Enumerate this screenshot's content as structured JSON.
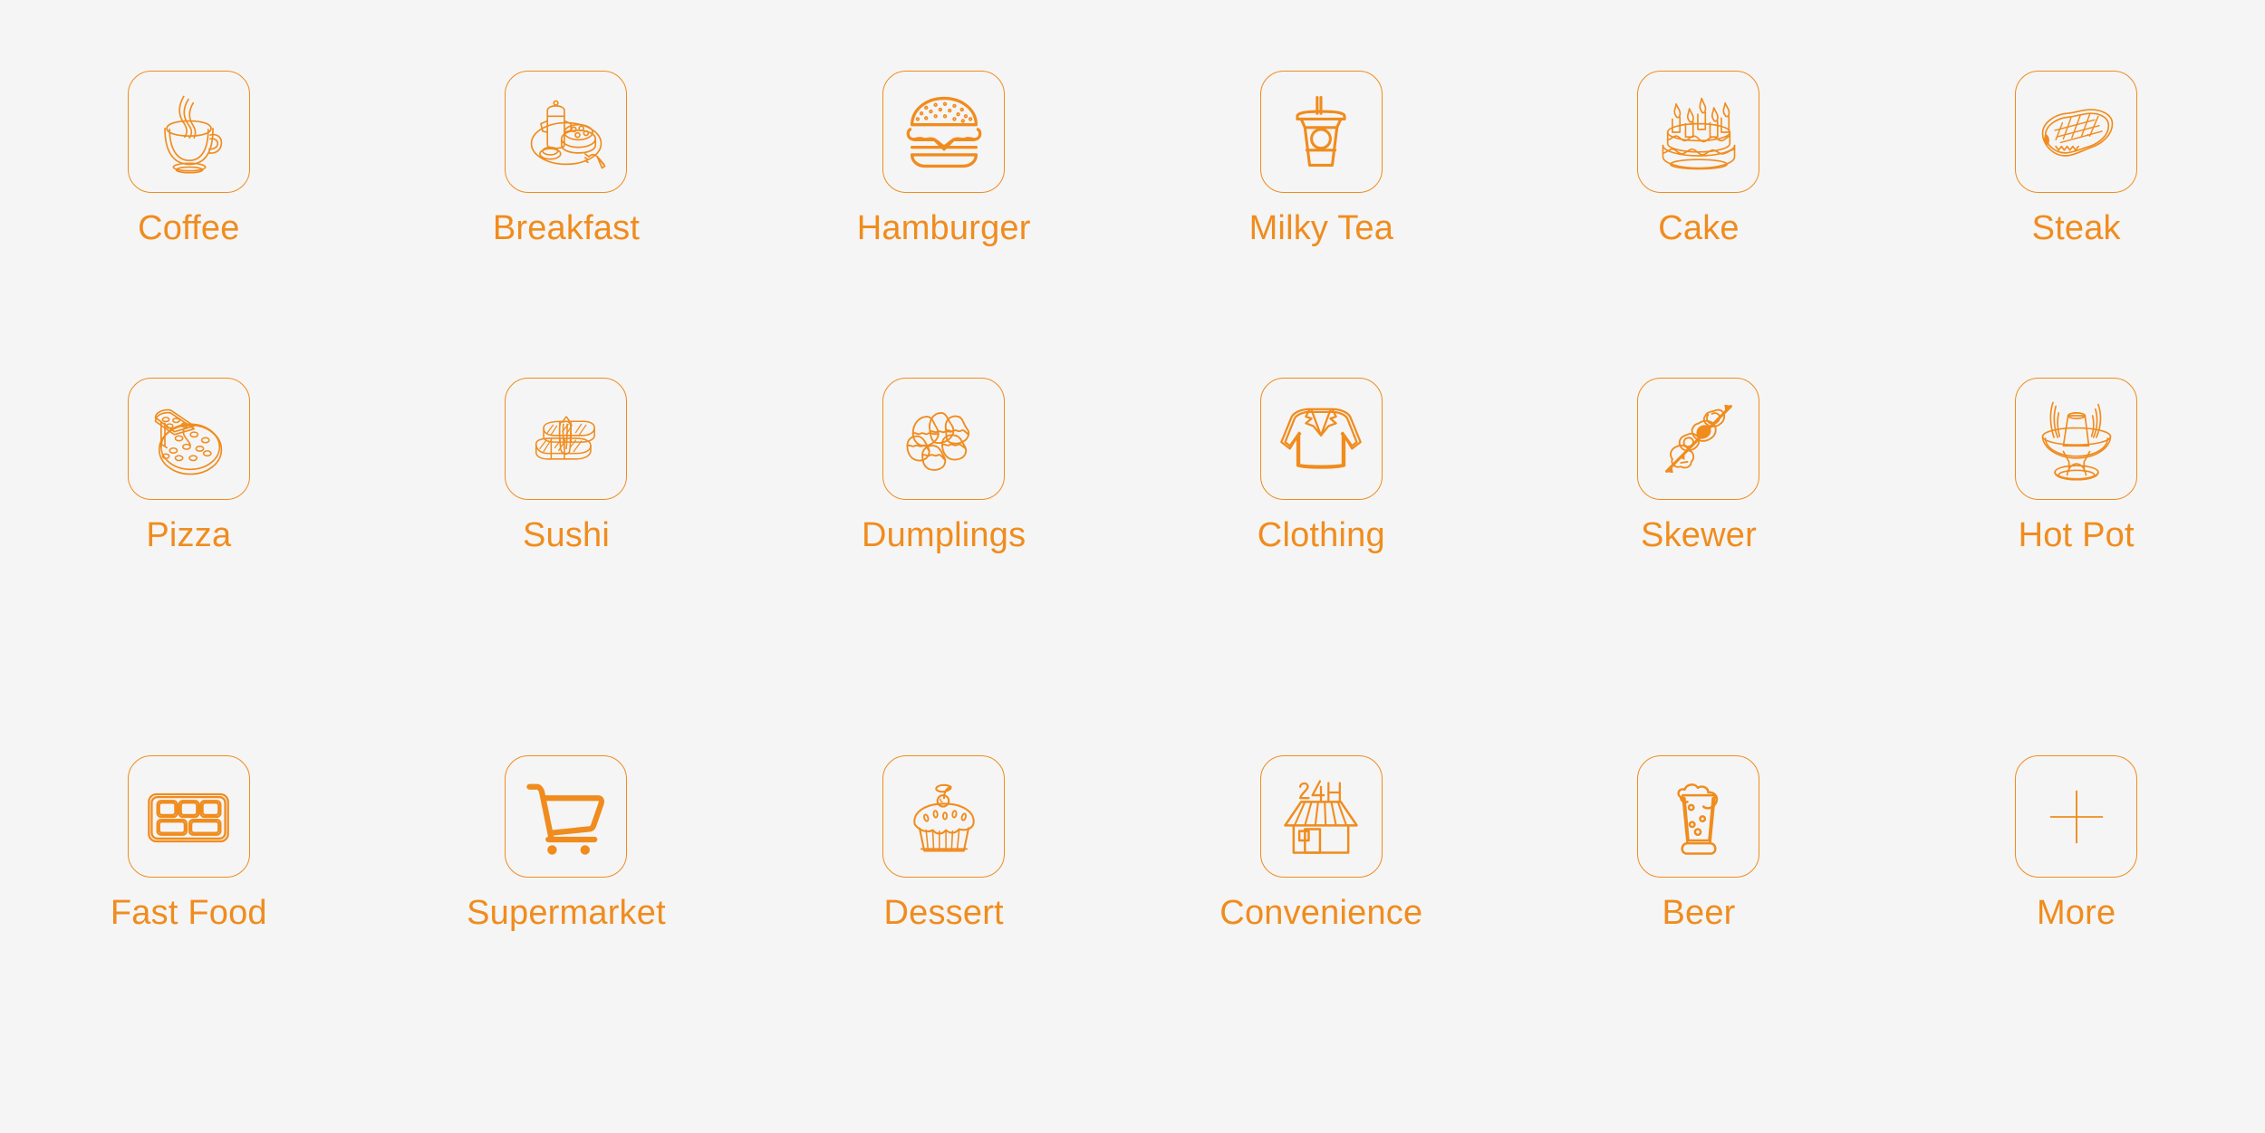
{
  "page": {
    "background_color": "#f5f5f5",
    "accent_color": "#F08C1E",
    "columns": 6,
    "rows": 3
  },
  "categories": [
    {
      "label": "Coffee",
      "icon": "coffee-cup-icon"
    },
    {
      "label": "Breakfast",
      "icon": "breakfast-tray-icon"
    },
    {
      "label": "Hamburger",
      "icon": "hamburger-icon"
    },
    {
      "label": "Milky Tea",
      "icon": "milk-tea-cup-icon"
    },
    {
      "label": "Cake",
      "icon": "birthday-cake-icon"
    },
    {
      "label": "Steak",
      "icon": "steak-icon"
    },
    {
      "label": "Pizza",
      "icon": "pizza-icon"
    },
    {
      "label": "Sushi",
      "icon": "sushi-icon"
    },
    {
      "label": "Dumplings",
      "icon": "dumplings-icon"
    },
    {
      "label": "Clothing",
      "icon": "shirt-icon"
    },
    {
      "label": "Skewer",
      "icon": "skewer-icon"
    },
    {
      "label": "Hot Pot",
      "icon": "hot-pot-icon"
    },
    {
      "label": "Fast Food",
      "icon": "bento-tray-icon"
    },
    {
      "label": "Supermarket",
      "icon": "shopping-cart-icon"
    },
    {
      "label": "Dessert",
      "icon": "cupcake-icon"
    },
    {
      "label": "Convenience",
      "icon": "convenience-store-icon"
    },
    {
      "label": "Beer",
      "icon": "beer-mug-icon"
    },
    {
      "label": "More",
      "icon": "plus-icon"
    }
  ],
  "store_sign_text": "24H"
}
